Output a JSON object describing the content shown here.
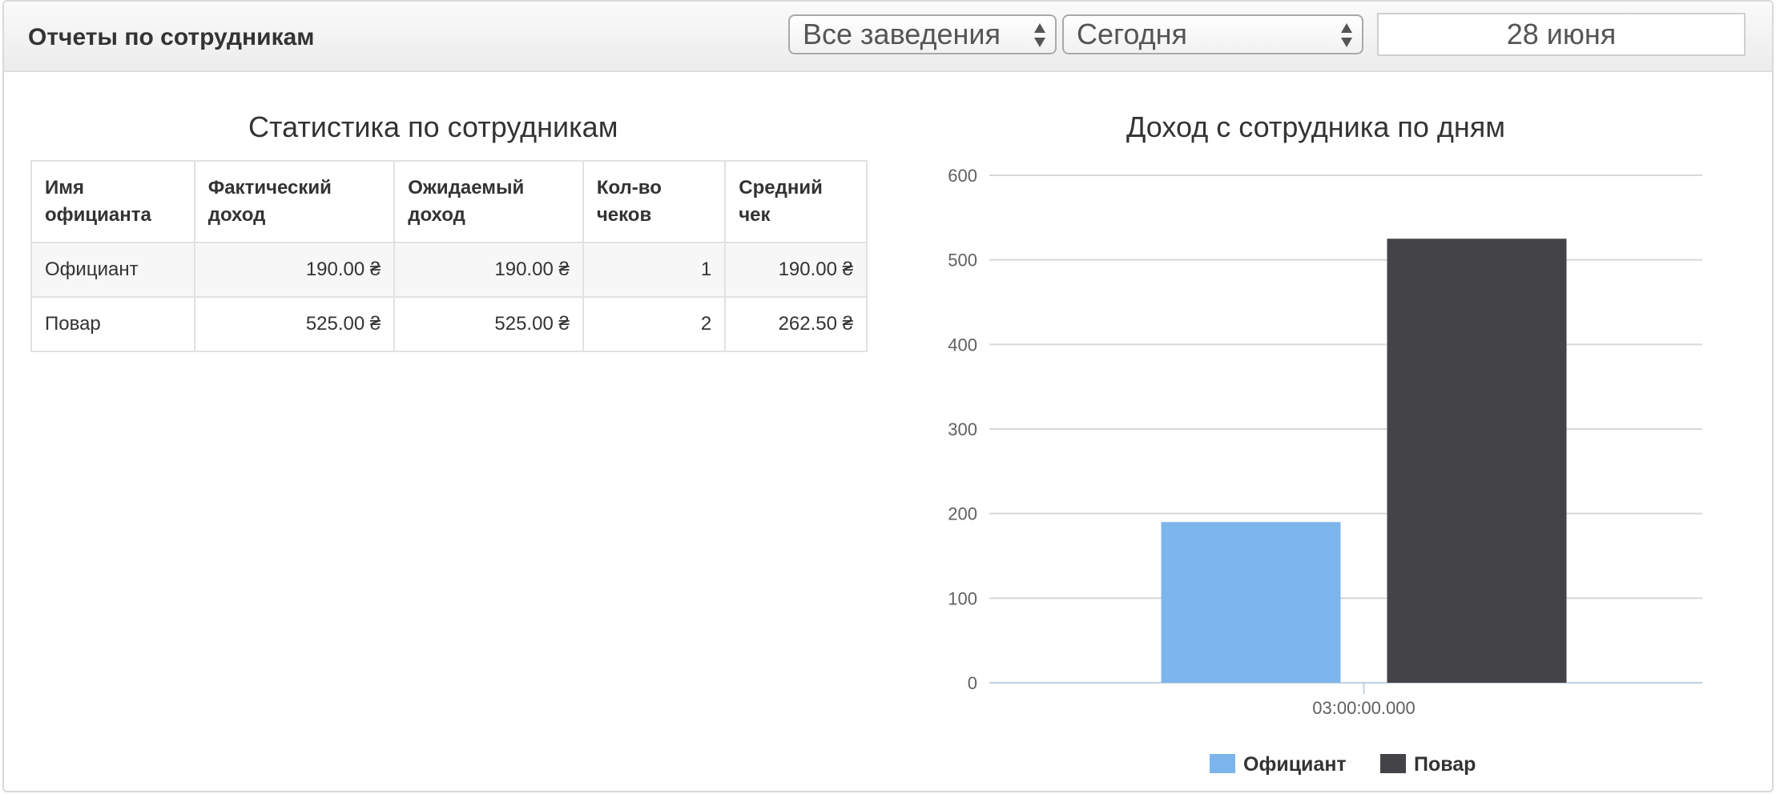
{
  "header": {
    "title": "Отчеты по сотрудникам",
    "venue_select": "Все заведения",
    "period_select": "Сегодня",
    "date": "28 июня"
  },
  "table": {
    "title": "Статистика по сотрудникам",
    "columns": [
      [
        "Имя",
        "официанта"
      ],
      [
        "Фактический",
        "доход"
      ],
      [
        "Ожидаемый",
        "доход"
      ],
      [
        "Кол-во",
        "чеков"
      ],
      [
        "Средний",
        "чек"
      ]
    ],
    "rows": [
      [
        "Официант",
        "190.00 ₴",
        "190.00 ₴",
        "1",
        "190.00 ₴"
      ],
      [
        "Повар",
        "525.00 ₴",
        "525.00 ₴",
        "2",
        "262.50 ₴"
      ]
    ]
  },
  "chart_data": {
    "type": "bar",
    "title": "Доход с сотрудника по дням",
    "categories": [
      "03:00:00.000"
    ],
    "series": [
      {
        "name": "Официант",
        "values": [
          190
        ],
        "color": "#7cb5ec"
      },
      {
        "name": "Повар",
        "values": [
          525
        ],
        "color": "#434348"
      }
    ],
    "ylim": [
      0,
      600
    ],
    "yticks": [
      0,
      100,
      200,
      300,
      400,
      500,
      600
    ],
    "grid": true,
    "legend": "bottom"
  }
}
